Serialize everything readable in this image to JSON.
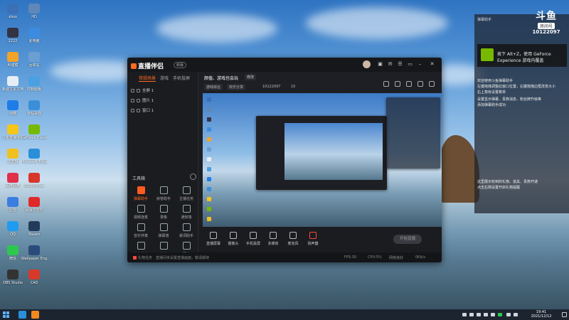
{
  "desktop": {
    "icons": [
      {
        "label": "xbox",
        "color": "#3b6fb6"
      },
      {
        "label": "HD",
        "color": "#5f87b8"
      },
      {
        "label": "2222",
        "color": "#334"
      },
      {
        "label": "此电脑",
        "color": "#3b8be0"
      },
      {
        "label": "AI建模",
        "color": "#f2a32a"
      },
      {
        "label": "回收站",
        "color": "#6b9fd1"
      },
      {
        "label": "新建文本文档",
        "color": "#e6eef5"
      },
      {
        "label": "控制面板",
        "color": "#4aa0e0"
      },
      {
        "label": "网络",
        "color": "#1e7de6"
      },
      {
        "label": "远程桌面",
        "color": "#3a8fd8"
      },
      {
        "label": "斗鱼直播伴侣",
        "color": "#f5c518"
      },
      {
        "label": "GeForce Experience",
        "color": "#76b900"
      },
      {
        "label": "快剪辑",
        "color": "#f0c020"
      },
      {
        "label": "Microsoft Edge",
        "color": "#2a8fd8"
      },
      {
        "label": "百度网盘",
        "color": "#e0304a"
      },
      {
        "label": "WPS Office",
        "color": "#d9362b"
      },
      {
        "label": "迅雷",
        "color": "#3b7de0"
      },
      {
        "label": "网易云音乐",
        "color": "#e02a2a"
      },
      {
        "label": "QQ",
        "color": "#1f9cf0"
      },
      {
        "label": "Steam",
        "color": "#233b5a"
      },
      {
        "label": "微信",
        "color": "#2ec84e"
      },
      {
        "label": "Wallpaper Engine",
        "color": "#2b4b7a"
      },
      {
        "label": "OBS Studio",
        "color": "#333"
      },
      {
        "label": "CAD",
        "color": "#d83a2a"
      }
    ]
  },
  "app": {
    "name": "直播伴侣",
    "version": "新版",
    "tabs": [
      "常规场景",
      "游戏",
      "手机投屏"
    ],
    "scenes": [
      "全屏 1",
      "图片 1",
      "窗口 1"
    ],
    "tools_title": "工具箱",
    "tools": [
      {
        "label": "弹幕助手",
        "hot": true
      },
      {
        "label": "房管助手",
        "hot": false
      },
      {
        "label": "主播任务",
        "hot": false
      },
      {
        "label": "视频连麦",
        "hot": false
      },
      {
        "label": "录像",
        "hot": false
      },
      {
        "label": "通知墙",
        "hot": false
      },
      {
        "label": "音乐伴奏",
        "hot": false
      },
      {
        "label": "弹幕墙",
        "hot": false
      },
      {
        "label": "歌词助手",
        "hot": false
      },
      {
        "label": "礼物特效",
        "hot": false
      },
      {
        "label": "抽奖",
        "hot": false
      },
      {
        "label": "更多",
        "hot": false
      }
    ],
    "stream_title": "颜值、游戏也会玩",
    "stream_tag": "修改",
    "category_chip": "游戏综合",
    "subcategory_chip": "欢乐分享",
    "meta_room": "10122097",
    "meta_followers": "15",
    "bottom_buttons": [
      {
        "label": "直播屏幕",
        "red": false
      },
      {
        "label": "摄像头",
        "red": false
      },
      {
        "label": "手机投屏",
        "red": false
      },
      {
        "label": "多媒体",
        "red": false
      },
      {
        "label": "麦克风",
        "red": false
      },
      {
        "label": "扬声器",
        "red": true
      }
    ],
    "start_live": "开始直播",
    "status_left": "礼物任务",
    "status_msg": "直播间未设置直播画面，敬请期待",
    "status_fps": "FPS:30",
    "status_cpu": "CPU:5%",
    "status_net": "网络良好",
    "status_rate": "0Kb/s"
  },
  "side_panel": {
    "header": "弹幕助手",
    "brand_logo": "斗鱼",
    "brand_sub": "房间号",
    "room_id": "10122097",
    "notice_line1": "按下 Alt+Z，使用 GeForce",
    "notice_line2": "Experience 游戏内覆盖",
    "welcome_lines": [
      "欢迎使用斗鱼弹幕助手",
      "左键拖拽调整此窗口位置，右键拖拽边框改变大小",
      "右上角有设置菜单",
      "设置显示弹幕、贵族消息、粉丝牌升级等",
      "添加弹幕助手成功"
    ],
    "gift_lines": [
      "这里展示收到的礼物、道具、贵族开通",
      "点击右侧设置开启礼物提醒"
    ]
  },
  "taskbar": {
    "time": "19:41",
    "date": "2021/12/12"
  }
}
